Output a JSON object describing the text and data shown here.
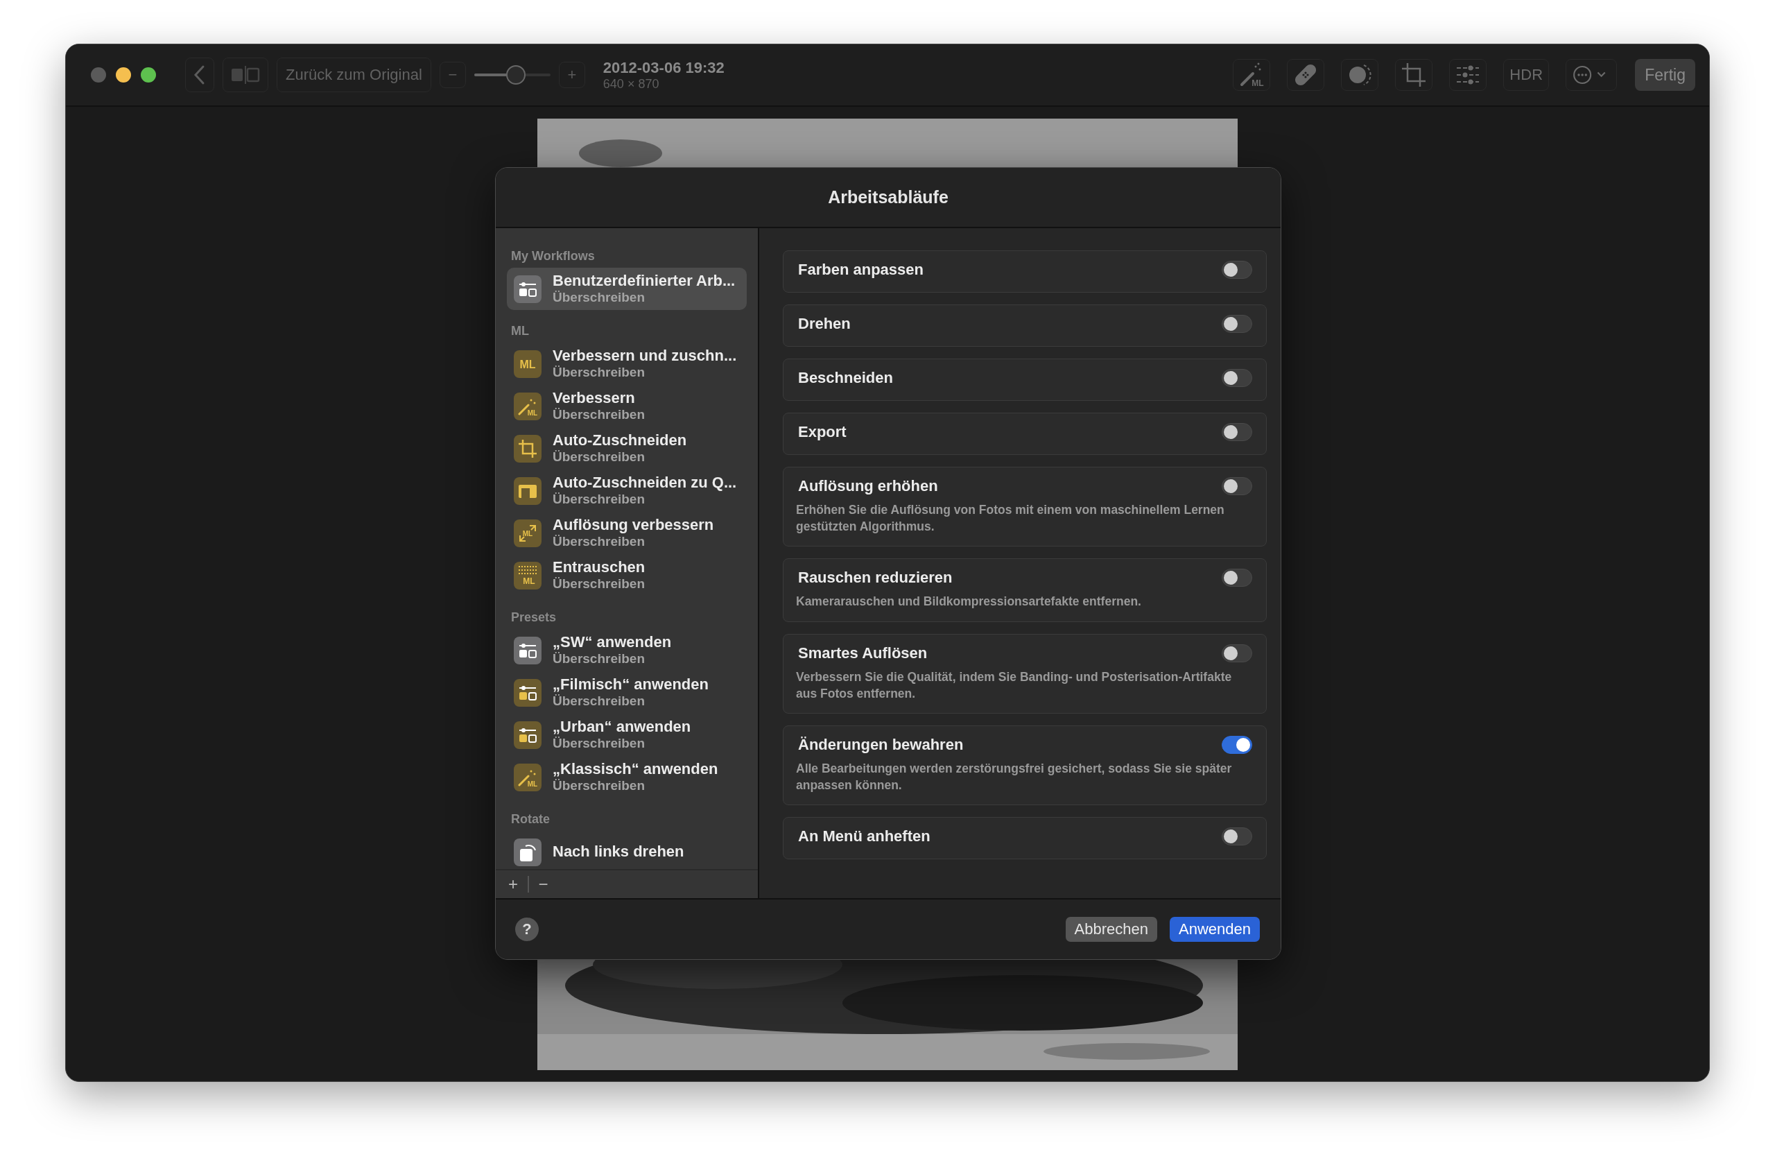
{
  "toolbar": {
    "revert_button": {
      "label": "Zurück zum Original",
      "disabled": true
    },
    "zoom": {
      "minus": "−",
      "plus": "+",
      "level": 0.55
    },
    "photo_info": {
      "date": "2012-03-06 19:32",
      "size": "640 × 870"
    },
    "tools": [
      {
        "kind": "wand",
        "icon_text": "ML"
      },
      {
        "kind": "bandage"
      },
      {
        "kind": "retouch"
      },
      {
        "kind": "crop"
      },
      {
        "kind": "adjust"
      },
      {
        "kind": "text",
        "label": "HDR"
      },
      {
        "kind": "more"
      }
    ],
    "done_button": "Fertig"
  },
  "dialog": {
    "title": "Arbeitsabläufe",
    "sidebar": {
      "sections": [
        {
          "title": "My Workflows",
          "items": [
            {
              "title": "Benutzerdefinierter Arb...",
              "subtitle": "Überschreiben",
              "kind": "sliders",
              "color": "#6e6e70",
              "selected": true
            }
          ]
        },
        {
          "title": "ML",
          "items": [
            {
              "title": "Verbessern und zuschn...",
              "subtitle": "Überschreiben",
              "kind": "ml",
              "icon_text": "ML",
              "color": "#6b5b2e",
              "selected": false
            },
            {
              "title": "Verbessern",
              "subtitle": "Überschreiben",
              "kind": "wand",
              "icon_text": "ML",
              "color": "#6b5b2e",
              "selected": false
            },
            {
              "title": "Auto-Zuschneiden",
              "subtitle": "Überschreiben",
              "kind": "crop",
              "color": "#6b5b2e",
              "selected": false
            },
            {
              "title": "Auto-Zuschneiden zu Q...",
              "subtitle": "Überschreiben",
              "kind": "aspect",
              "color": "#6b5b2e",
              "selected": false
            },
            {
              "title": "Auflösung verbessern",
              "subtitle": "Überschreiben",
              "kind": "resolution",
              "icon_text": "ML",
              "color": "#6b5b2e",
              "selected": false
            },
            {
              "title": "Entrauschen",
              "subtitle": "Überschreiben",
              "kind": "denoise",
              "icon_text": "ML",
              "color": "#6b5b2e",
              "selected": false
            }
          ]
        },
        {
          "title": "Presets",
          "items": [
            {
              "title": "„SW“ anwenden",
              "subtitle": "Überschreiben",
              "kind": "sliders",
              "color": "#6e6e70",
              "selected": false
            },
            {
              "title": "„Filmisch“ anwenden",
              "subtitle": "Überschreiben",
              "kind": "sliders",
              "color": "#6b5b2e",
              "selected": false
            },
            {
              "title": "„Urban“ anwenden",
              "subtitle": "Überschreiben",
              "kind": "sliders",
              "color": "#6b5b2e",
              "selected": false
            },
            {
              "title": "„Klassisch“ anwenden",
              "subtitle": "Überschreiben",
              "kind": "wand",
              "icon_text": "ML",
              "color": "#6b5b2e",
              "selected": false
            }
          ]
        },
        {
          "title": "Rotate",
          "items": [
            {
              "title": "Nach links drehen",
              "kind": "rotate",
              "color": "#6e6e70",
              "selected": false
            }
          ]
        }
      ],
      "add": "+",
      "remove": "−"
    },
    "options": [
      {
        "label": "Farben anpassen",
        "on": false
      },
      {
        "label": "Drehen",
        "on": false
      },
      {
        "label": "Beschneiden",
        "on": false
      },
      {
        "label": "Export",
        "on": false
      },
      {
        "label": "Auflösung erhöhen",
        "description": "Erhöhen Sie die Auflösung von Fotos mit einem von maschinellem Lernen gestützten Algorithmus.",
        "on": false
      },
      {
        "label": "Rauschen reduzieren",
        "description": "Kamerarauschen und Bildkompressionsartefakte entfernen.",
        "on": false
      },
      {
        "label": "Smartes Auflösen",
        "description": "Verbessern Sie die Qualität, indem Sie Banding- und Posterisation-Artifakte aus Fotos entfernen.",
        "on": false
      },
      {
        "label": "Änderungen bewahren",
        "description": "Alle Bearbeitungen werden zerstörungsfrei gesichert, sodass Sie sie später anpassen können.",
        "on": true
      },
      {
        "label": "An Menü anheften",
        "on": false
      }
    ],
    "help": "?",
    "cancel_button": "Abbrechen",
    "apply_button": "Anwenden"
  }
}
